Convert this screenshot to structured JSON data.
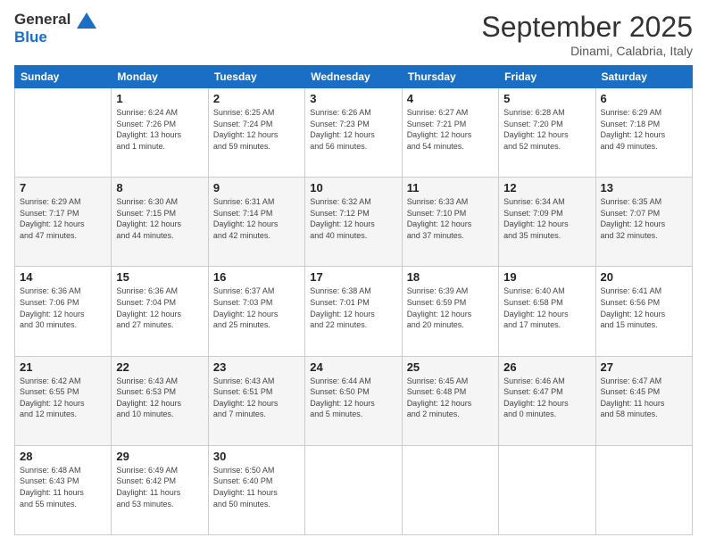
{
  "logo": {
    "line1": "General",
    "line2": "Blue"
  },
  "title": "September 2025",
  "location": "Dinami, Calabria, Italy",
  "weekdays": [
    "Sunday",
    "Monday",
    "Tuesday",
    "Wednesday",
    "Thursday",
    "Friday",
    "Saturday"
  ],
  "weeks": [
    [
      {
        "day": "",
        "info": ""
      },
      {
        "day": "1",
        "info": "Sunrise: 6:24 AM\nSunset: 7:26 PM\nDaylight: 13 hours\nand 1 minute."
      },
      {
        "day": "2",
        "info": "Sunrise: 6:25 AM\nSunset: 7:24 PM\nDaylight: 12 hours\nand 59 minutes."
      },
      {
        "day": "3",
        "info": "Sunrise: 6:26 AM\nSunset: 7:23 PM\nDaylight: 12 hours\nand 56 minutes."
      },
      {
        "day": "4",
        "info": "Sunrise: 6:27 AM\nSunset: 7:21 PM\nDaylight: 12 hours\nand 54 minutes."
      },
      {
        "day": "5",
        "info": "Sunrise: 6:28 AM\nSunset: 7:20 PM\nDaylight: 12 hours\nand 52 minutes."
      },
      {
        "day": "6",
        "info": "Sunrise: 6:29 AM\nSunset: 7:18 PM\nDaylight: 12 hours\nand 49 minutes."
      }
    ],
    [
      {
        "day": "7",
        "info": "Sunrise: 6:29 AM\nSunset: 7:17 PM\nDaylight: 12 hours\nand 47 minutes."
      },
      {
        "day": "8",
        "info": "Sunrise: 6:30 AM\nSunset: 7:15 PM\nDaylight: 12 hours\nand 44 minutes."
      },
      {
        "day": "9",
        "info": "Sunrise: 6:31 AM\nSunset: 7:14 PM\nDaylight: 12 hours\nand 42 minutes."
      },
      {
        "day": "10",
        "info": "Sunrise: 6:32 AM\nSunset: 7:12 PM\nDaylight: 12 hours\nand 40 minutes."
      },
      {
        "day": "11",
        "info": "Sunrise: 6:33 AM\nSunset: 7:10 PM\nDaylight: 12 hours\nand 37 minutes."
      },
      {
        "day": "12",
        "info": "Sunrise: 6:34 AM\nSunset: 7:09 PM\nDaylight: 12 hours\nand 35 minutes."
      },
      {
        "day": "13",
        "info": "Sunrise: 6:35 AM\nSunset: 7:07 PM\nDaylight: 12 hours\nand 32 minutes."
      }
    ],
    [
      {
        "day": "14",
        "info": "Sunrise: 6:36 AM\nSunset: 7:06 PM\nDaylight: 12 hours\nand 30 minutes."
      },
      {
        "day": "15",
        "info": "Sunrise: 6:36 AM\nSunset: 7:04 PM\nDaylight: 12 hours\nand 27 minutes."
      },
      {
        "day": "16",
        "info": "Sunrise: 6:37 AM\nSunset: 7:03 PM\nDaylight: 12 hours\nand 25 minutes."
      },
      {
        "day": "17",
        "info": "Sunrise: 6:38 AM\nSunset: 7:01 PM\nDaylight: 12 hours\nand 22 minutes."
      },
      {
        "day": "18",
        "info": "Sunrise: 6:39 AM\nSunset: 6:59 PM\nDaylight: 12 hours\nand 20 minutes."
      },
      {
        "day": "19",
        "info": "Sunrise: 6:40 AM\nSunset: 6:58 PM\nDaylight: 12 hours\nand 17 minutes."
      },
      {
        "day": "20",
        "info": "Sunrise: 6:41 AM\nSunset: 6:56 PM\nDaylight: 12 hours\nand 15 minutes."
      }
    ],
    [
      {
        "day": "21",
        "info": "Sunrise: 6:42 AM\nSunset: 6:55 PM\nDaylight: 12 hours\nand 12 minutes."
      },
      {
        "day": "22",
        "info": "Sunrise: 6:43 AM\nSunset: 6:53 PM\nDaylight: 12 hours\nand 10 minutes."
      },
      {
        "day": "23",
        "info": "Sunrise: 6:43 AM\nSunset: 6:51 PM\nDaylight: 12 hours\nand 7 minutes."
      },
      {
        "day": "24",
        "info": "Sunrise: 6:44 AM\nSunset: 6:50 PM\nDaylight: 12 hours\nand 5 minutes."
      },
      {
        "day": "25",
        "info": "Sunrise: 6:45 AM\nSunset: 6:48 PM\nDaylight: 12 hours\nand 2 minutes."
      },
      {
        "day": "26",
        "info": "Sunrise: 6:46 AM\nSunset: 6:47 PM\nDaylight: 12 hours\nand 0 minutes."
      },
      {
        "day": "27",
        "info": "Sunrise: 6:47 AM\nSunset: 6:45 PM\nDaylight: 11 hours\nand 58 minutes."
      }
    ],
    [
      {
        "day": "28",
        "info": "Sunrise: 6:48 AM\nSunset: 6:43 PM\nDaylight: 11 hours\nand 55 minutes."
      },
      {
        "day": "29",
        "info": "Sunrise: 6:49 AM\nSunset: 6:42 PM\nDaylight: 11 hours\nand 53 minutes."
      },
      {
        "day": "30",
        "info": "Sunrise: 6:50 AM\nSunset: 6:40 PM\nDaylight: 11 hours\nand 50 minutes."
      },
      {
        "day": "",
        "info": ""
      },
      {
        "day": "",
        "info": ""
      },
      {
        "day": "",
        "info": ""
      },
      {
        "day": "",
        "info": ""
      }
    ]
  ]
}
